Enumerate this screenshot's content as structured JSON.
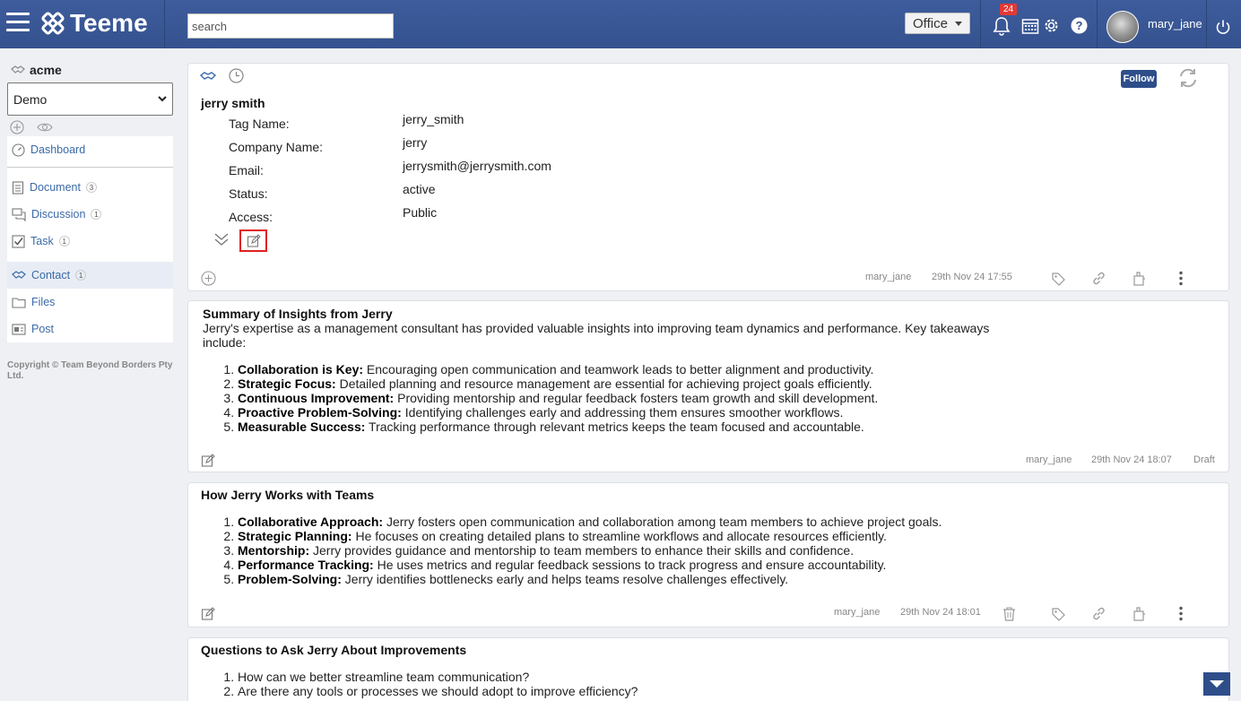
{
  "header": {
    "app_name": "Teeme",
    "search_placeholder": "search",
    "office_label": "Office",
    "notification_count": "24",
    "username": "mary_jane"
  },
  "sidebar": {
    "org_name": "acme",
    "workspace_selected": "Demo",
    "items": [
      {
        "label": "Dashboard",
        "count": ""
      },
      {
        "label": "Document",
        "count": "3"
      },
      {
        "label": "Discussion",
        "count": "1"
      },
      {
        "label": "Task",
        "count": "1"
      },
      {
        "label": "Contact",
        "count": "1"
      },
      {
        "label": "Files",
        "count": ""
      },
      {
        "label": "Post",
        "count": ""
      }
    ],
    "copyright": "Copyright © Team Beyond Borders Pty Ltd."
  },
  "contact_card": {
    "name": "jerry smith",
    "follow_label": "Follow",
    "fields": [
      {
        "label": "Tag Name:",
        "value": "jerry_smith"
      },
      {
        "label": "Company Name:",
        "value": "jerry"
      },
      {
        "label": "Email:",
        "value": "jerrysmith@jerrysmith.com"
      },
      {
        "label": "Status:",
        "value": "active"
      },
      {
        "label": "Access:",
        "value": "Public"
      }
    ],
    "author": "mary_jane",
    "timestamp": "29th Nov 24 17:55"
  },
  "note1": {
    "title": "Summary of Insights from Jerry",
    "intro": "Jerry's expertise as a management consultant has provided valuable insights into improving team dynamics and performance. Key takeaways include:",
    "items": [
      {
        "bold": "Collaboration is Key:",
        "text": " Encouraging open communication and teamwork leads to better alignment and productivity."
      },
      {
        "bold": "Strategic Focus:",
        "text": " Detailed planning and resource management are essential for achieving project goals efficiently."
      },
      {
        "bold": "Continuous Improvement:",
        "text": " Providing mentorship and regular feedback fosters team growth and skill development."
      },
      {
        "bold": "Proactive Problem-Solving:",
        "text": " Identifying challenges early and addressing them ensures smoother workflows."
      },
      {
        "bold": "Measurable Success:",
        "text": " Tracking performance through relevant metrics keeps the team focused and accountable."
      }
    ],
    "author": "mary_jane",
    "timestamp": "29th Nov 24 18:07",
    "status": "Draft"
  },
  "note2": {
    "title": "How Jerry Works with Teams",
    "items": [
      {
        "bold": "Collaborative Approach:",
        "text": " Jerry fosters open communication and collaboration among team members to achieve project goals."
      },
      {
        "bold": "Strategic Planning:",
        "text": " He focuses on creating detailed plans to streamline workflows and allocate resources efficiently."
      },
      {
        "bold": "Mentorship:",
        "text": " Jerry provides guidance and mentorship to team members to enhance their skills and confidence."
      },
      {
        "bold": "Performance Tracking:",
        "text": " He uses metrics and regular feedback sessions to track progress and ensure accountability."
      },
      {
        "bold": "Problem-Solving:",
        "text": " Jerry identifies bottlenecks early and helps teams resolve challenges effectively."
      }
    ],
    "author": "mary_jane",
    "timestamp": "29th Nov 24 18:01"
  },
  "note3": {
    "title": "Questions to Ask Jerry About Improvements",
    "items": [
      "How can we better streamline team communication?",
      "Are there any tools or processes we should adopt to improve efficiency?"
    ]
  },
  "colors": {
    "header_bg": "#3e5c9c",
    "accent": "#2e4e8a",
    "link": "#3a6aa8",
    "badge": "#e53935",
    "highlight_border": "#e02020"
  },
  "icons": [
    "menu-icon",
    "teeme-logo-icon",
    "bell-icon",
    "calendar-icon",
    "gear-icon",
    "help-icon",
    "power-icon",
    "handshake-icon",
    "clock-icon",
    "refresh-icon",
    "chevron-double-down-icon",
    "edit-icon",
    "add-icon",
    "tag-icon",
    "link-icon",
    "clip-icon",
    "more-icon",
    "trash-icon"
  ]
}
